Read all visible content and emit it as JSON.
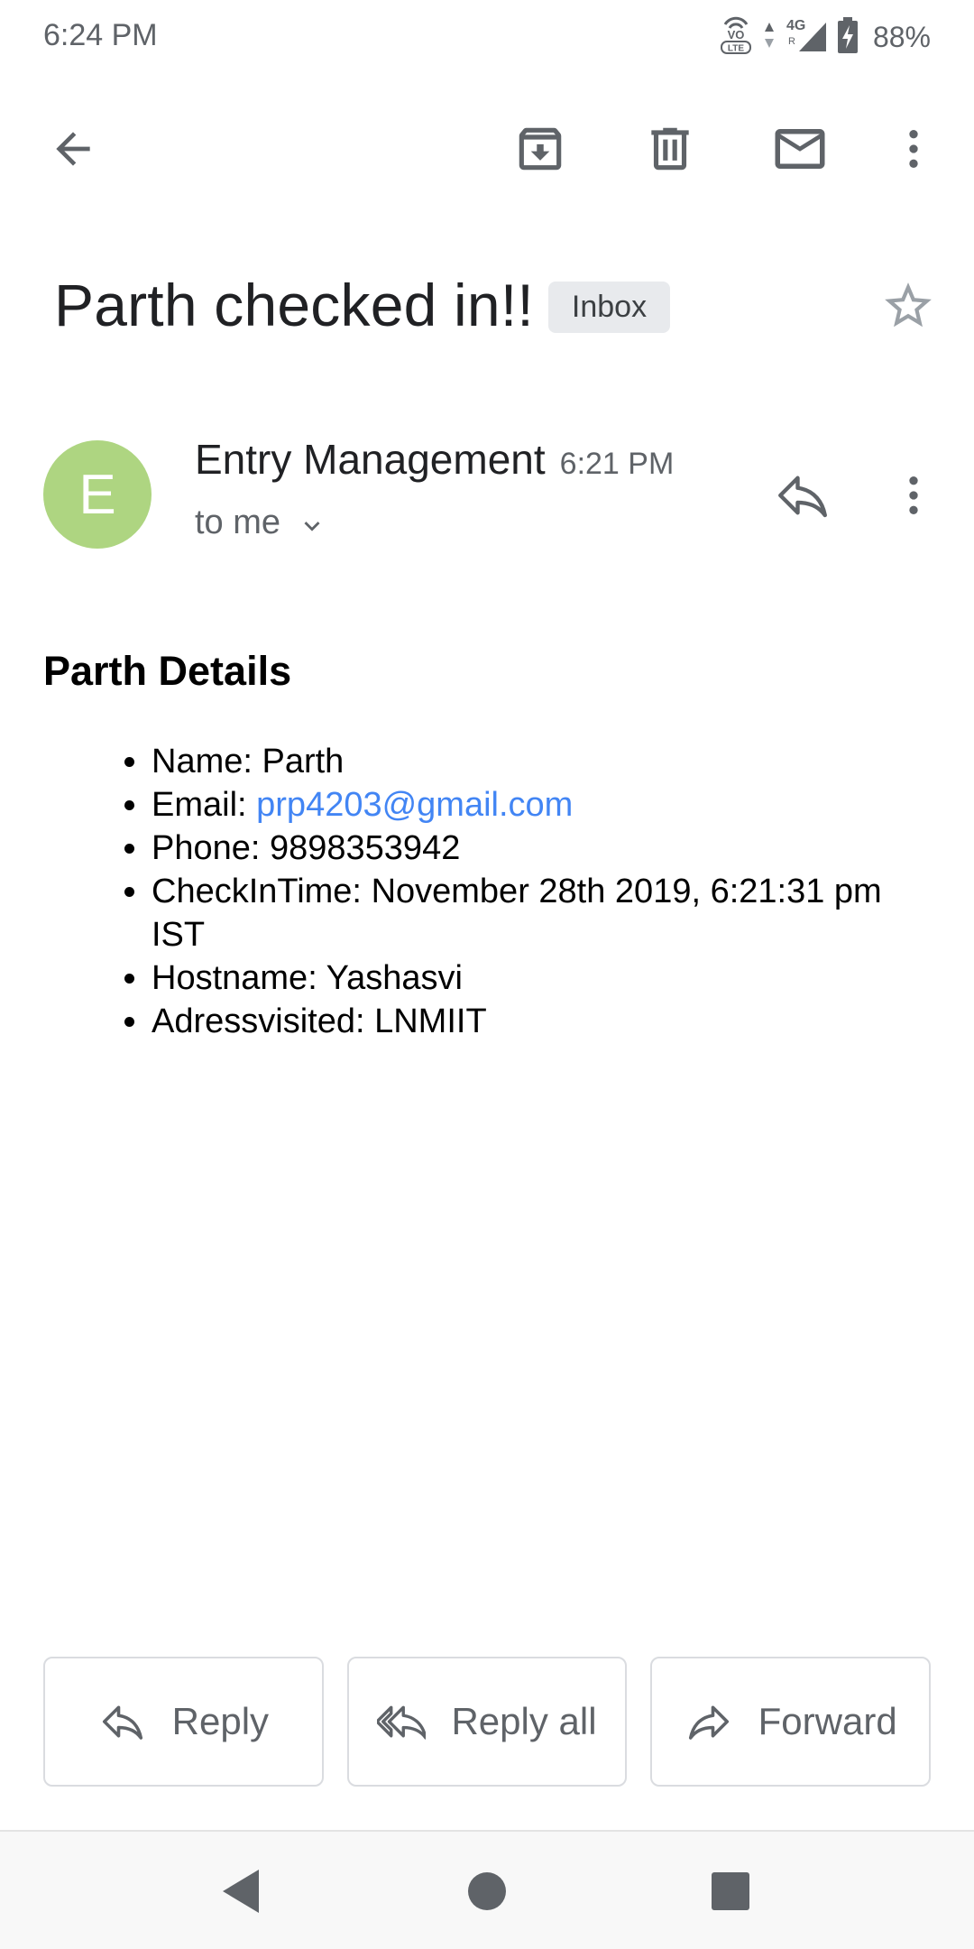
{
  "status_bar": {
    "time": "6:24 PM",
    "battery": "88%",
    "network": "4G",
    "icons": [
      "volte-icon",
      "data-activity-icon",
      "signal-4g-icon",
      "battery-charging-icon"
    ]
  },
  "toolbar": {
    "icons": [
      "back-arrow-icon",
      "archive-icon",
      "delete-icon",
      "mark-unread-icon",
      "more-vert-icon"
    ]
  },
  "email": {
    "subject": "Parth checked in!!",
    "label": "Inbox",
    "sender": {
      "initial": "E",
      "name": "Entry Management",
      "time": "6:21 PM",
      "recipient": "to me"
    },
    "body": {
      "heading": "Parth Details",
      "items": [
        {
          "label": "Name: ",
          "value": "Parth"
        },
        {
          "label": "Email: ",
          "value": "prp4203@gmail.com"
        },
        {
          "label": "Phone: ",
          "value": "9898353942"
        },
        {
          "label": "CheckInTime: ",
          "value": "November 28th 2019, 6:21:31 pm IST"
        },
        {
          "label": "Hostname: ",
          "value": "Yashasvi"
        },
        {
          "label": "Adressvisited: ",
          "value": "LNMIIT"
        }
      ]
    }
  },
  "actions": {
    "reply": "Reply",
    "reply_all": "Reply all",
    "forward": "Forward"
  },
  "colors": {
    "avatar": "#aed581",
    "link": "#4285f4",
    "icon_gray": "#5f6368",
    "chip_bg": "#e8eaed"
  }
}
